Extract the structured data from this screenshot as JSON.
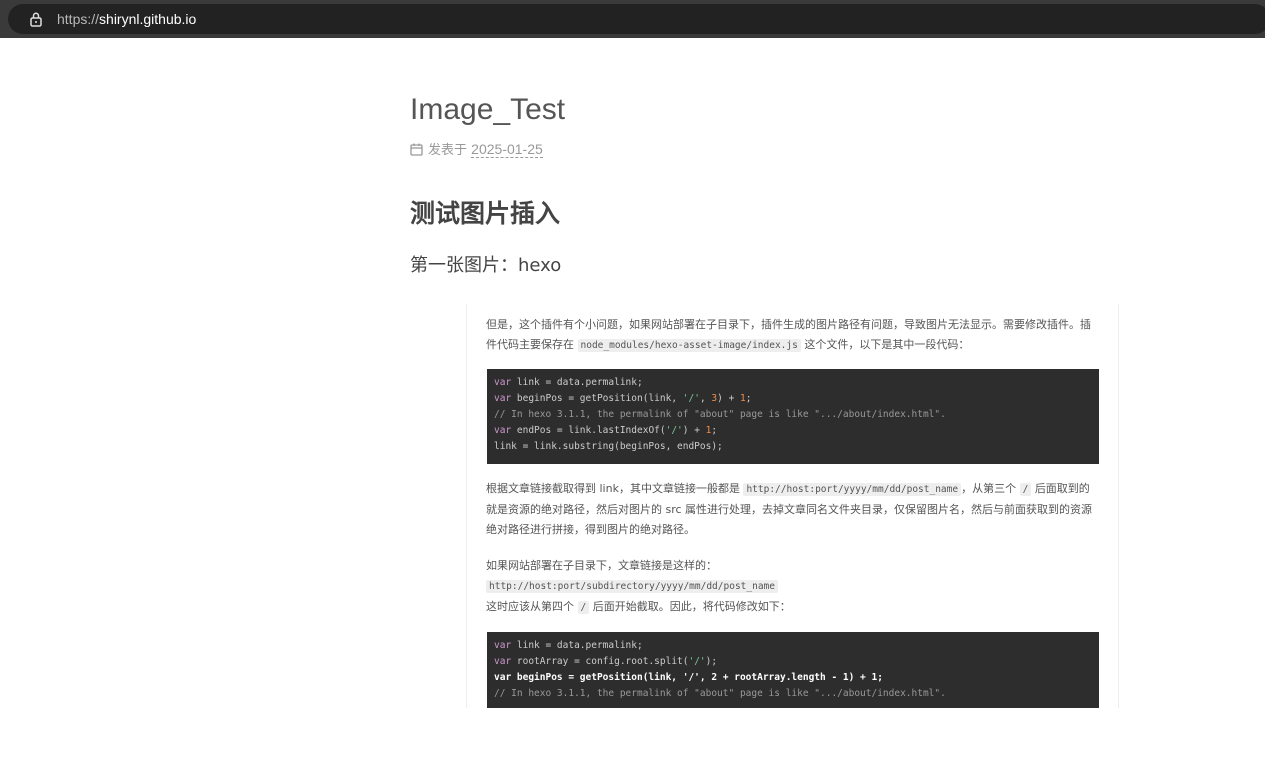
{
  "browser": {
    "url_scheme": "https://",
    "url_host": "shirynl.github.io"
  },
  "post": {
    "title": "Image_Test",
    "meta_prefix": "发表于",
    "date": "2025-01-25",
    "heading": "测试图片插入",
    "paragraph": "第一张图片：hexo"
  },
  "embedded_image": {
    "p1_a": "但是，这个插件有个小问题，如果网站部署在子目录下，插件生成的图片路径有问题，导致图片无法显示。需要修改插件。插件代码主要保存在",
    "p1_code": "node_modules/hexo-asset-image/index.js",
    "p1_b": "这个文件，以下是其中一段代码：",
    "code1": [
      {
        "kw": "var",
        "rest": " link = data.permalink;"
      },
      {
        "kw": "var",
        "rest": " beginPos = getPosition(link, ",
        "str": "'/'",
        "rest2": ", ",
        "num": "3",
        "rest3": ") + ",
        "num2": "1",
        "rest4": ";"
      },
      {
        "comment": "// In hexo 3.1.1, the permalink of \"about\" page is like \".../about/index.html\"."
      },
      {
        "kw": "var",
        "rest": " endPos = link.lastIndexOf(",
        "str": "'/'",
        "rest2": ") + ",
        "num": "1",
        "rest3": ";"
      },
      {
        "plain": "link = link.substring(beginPos, endPos);"
      }
    ],
    "p2_a": "根据文章链接截取得到 link，其中文章链接一般都是",
    "p2_code": "http://host:port/yyyy/mm/dd/post_name",
    "p2_b": "，从第三个",
    "p2_slash": "/",
    "p2_c": "后面取到的就是资源的绝对路径，然后对图片的 src 属性进行处理，去掉文章同名文件夹目录，仅保留图片名，然后与前面获取到的资源绝对路径进行拼接，得到图片的绝对路径。",
    "p3": "如果网站部署在子目录下，文章链接是这样的：",
    "p3_code": "http://host:port/subdirectory/yyyy/mm/dd/post_name",
    "p4_a": "这时应该从第四个",
    "p4_slash": "/",
    "p4_b": "后面开始截取。因此，将代码修改如下：",
    "code2": [
      {
        "kw": "var",
        "rest": " link = data.permalink;"
      },
      {
        "kw": "var",
        "rest": " rootArray = config.root.split(",
        "str": "'/'",
        "rest2": ");"
      },
      {
        "bold": "var beginPos = getPosition(link, '/', 2 + rootArray.length - 1) + 1;"
      },
      {
        "comment": "// In hexo 3.1.1, the permalink of \"about\" page is like \".../about/index.html\"."
      }
    ]
  },
  "colors": {
    "browser_bar": "#3a3a3a",
    "url_field": "#222222",
    "code_bg": "#2d2d2d",
    "keyword": "#cc99cd",
    "string": "#7ec699",
    "number": "#f08d49",
    "comment": "#999999"
  },
  "icons": {
    "lock": "lock-icon",
    "calendar": "calendar-icon"
  }
}
